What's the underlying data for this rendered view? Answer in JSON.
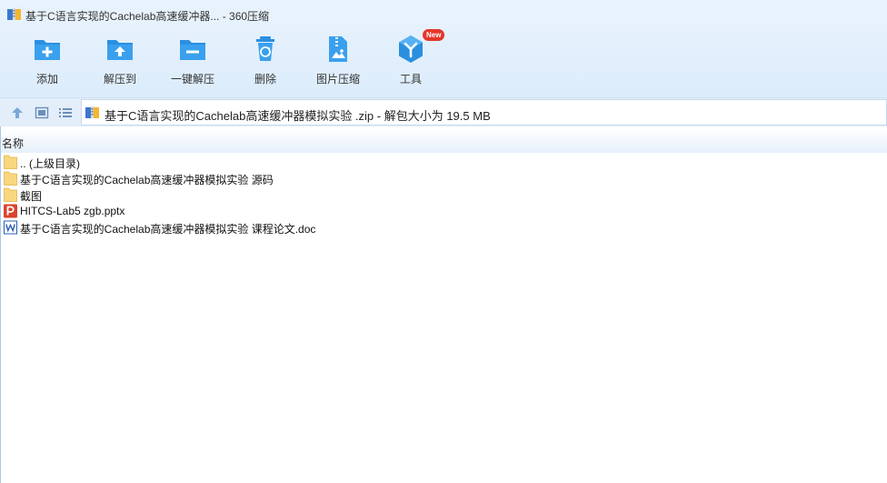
{
  "window": {
    "title": "基于C语言实现的Cachelab高速缓冲器... - 360压缩"
  },
  "toolbar": {
    "buttons": [
      {
        "label": "添加",
        "icon": "add-icon"
      },
      {
        "label": "解压到",
        "icon": "extract-to-icon"
      },
      {
        "label": "一键解压",
        "icon": "one-click-extract-icon"
      },
      {
        "label": "删除",
        "icon": "delete-icon"
      },
      {
        "label": "图片压缩",
        "icon": "image-compress-icon"
      },
      {
        "label": "工具",
        "icon": "tools-icon",
        "badge": "New"
      }
    ]
  },
  "addressbar": {
    "path": "基于C语言实现的Cachelab高速缓冲器模拟实验 .zip - 解包大小为 19.5 MB"
  },
  "file_list": {
    "column_name": "名称",
    "items": [
      {
        "name": ".. (上级目录)",
        "type": "folder"
      },
      {
        "name": "基于C语言实现的Cachelab高速缓冲器模拟实验 源码",
        "type": "folder"
      },
      {
        "name": "截图",
        "type": "folder"
      },
      {
        "name": "HITCS-Lab5 zgb.pptx",
        "type": "pptx"
      },
      {
        "name": "基于C语言实现的Cachelab高速缓冲器模拟实验 课程论文.doc",
        "type": "doc"
      }
    ]
  },
  "colors": {
    "accent": "#2b8fe0",
    "badge": "#e5352b",
    "folder": "#f9d77e",
    "ppt": "#d9432f",
    "word": "#2b5fb4"
  }
}
